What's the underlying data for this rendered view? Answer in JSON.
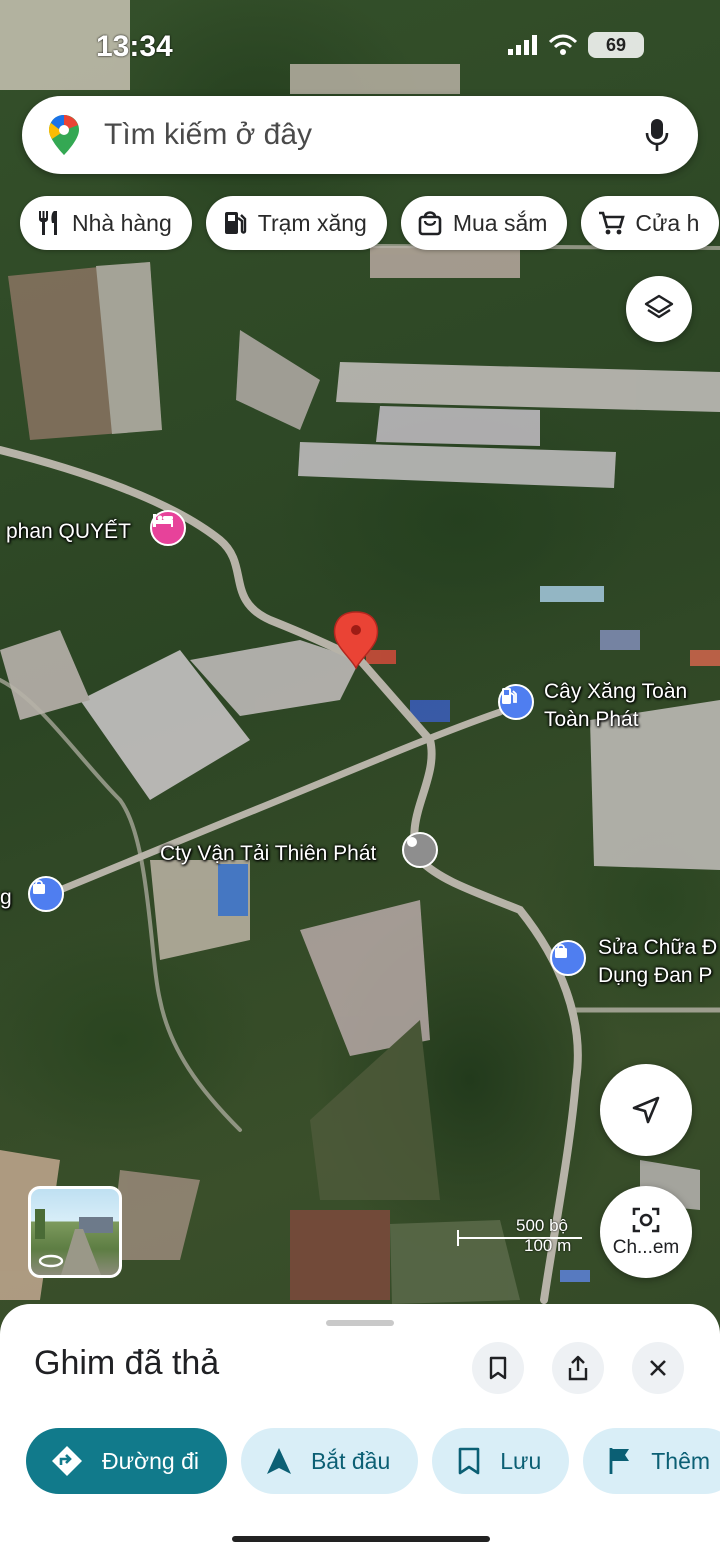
{
  "status_bar": {
    "time": "13:34",
    "battery": "69"
  },
  "search": {
    "placeholder": "Tìm kiếm ở đây"
  },
  "chips": [
    {
      "label": "Nhà hàng",
      "icon": "restaurant-icon"
    },
    {
      "label": "Trạm xăng",
      "icon": "gas-station-icon"
    },
    {
      "label": "Mua sắm",
      "icon": "shopping-bag-icon"
    },
    {
      "label": "Cửa h",
      "icon": "cart-icon"
    }
  ],
  "map": {
    "labels": {
      "hotel": "phan QUYẾT",
      "gas_station_1": "Cây Xăng Toàn",
      "gas_station_2": "Toàn Phát",
      "transport": "Cty Vận Tải Thiên Phát",
      "left_edge": "g",
      "repair_1": "Sửa Chữa Đ",
      "repair_2": "Dụng Đan P"
    },
    "scale_feet": "500 bộ",
    "scale_meters": "100 m",
    "camera_label": "Ch...em",
    "colors": {
      "pin": "#ea4335",
      "hotel_marker": "#e7429a",
      "poi_marker": "#4f7ef0",
      "transit_marker": "#8e8e8e"
    }
  },
  "sheet": {
    "title": "Ghim đã thả",
    "actions": [
      {
        "label": "Đường đi",
        "icon": "directions-icon"
      },
      {
        "label": "Bắt đầu",
        "icon": "navigation-arrow-icon"
      },
      {
        "label": "Lưu",
        "icon": "bookmark-icon"
      },
      {
        "label": "Thêm",
        "icon": "flag-icon"
      }
    ]
  }
}
